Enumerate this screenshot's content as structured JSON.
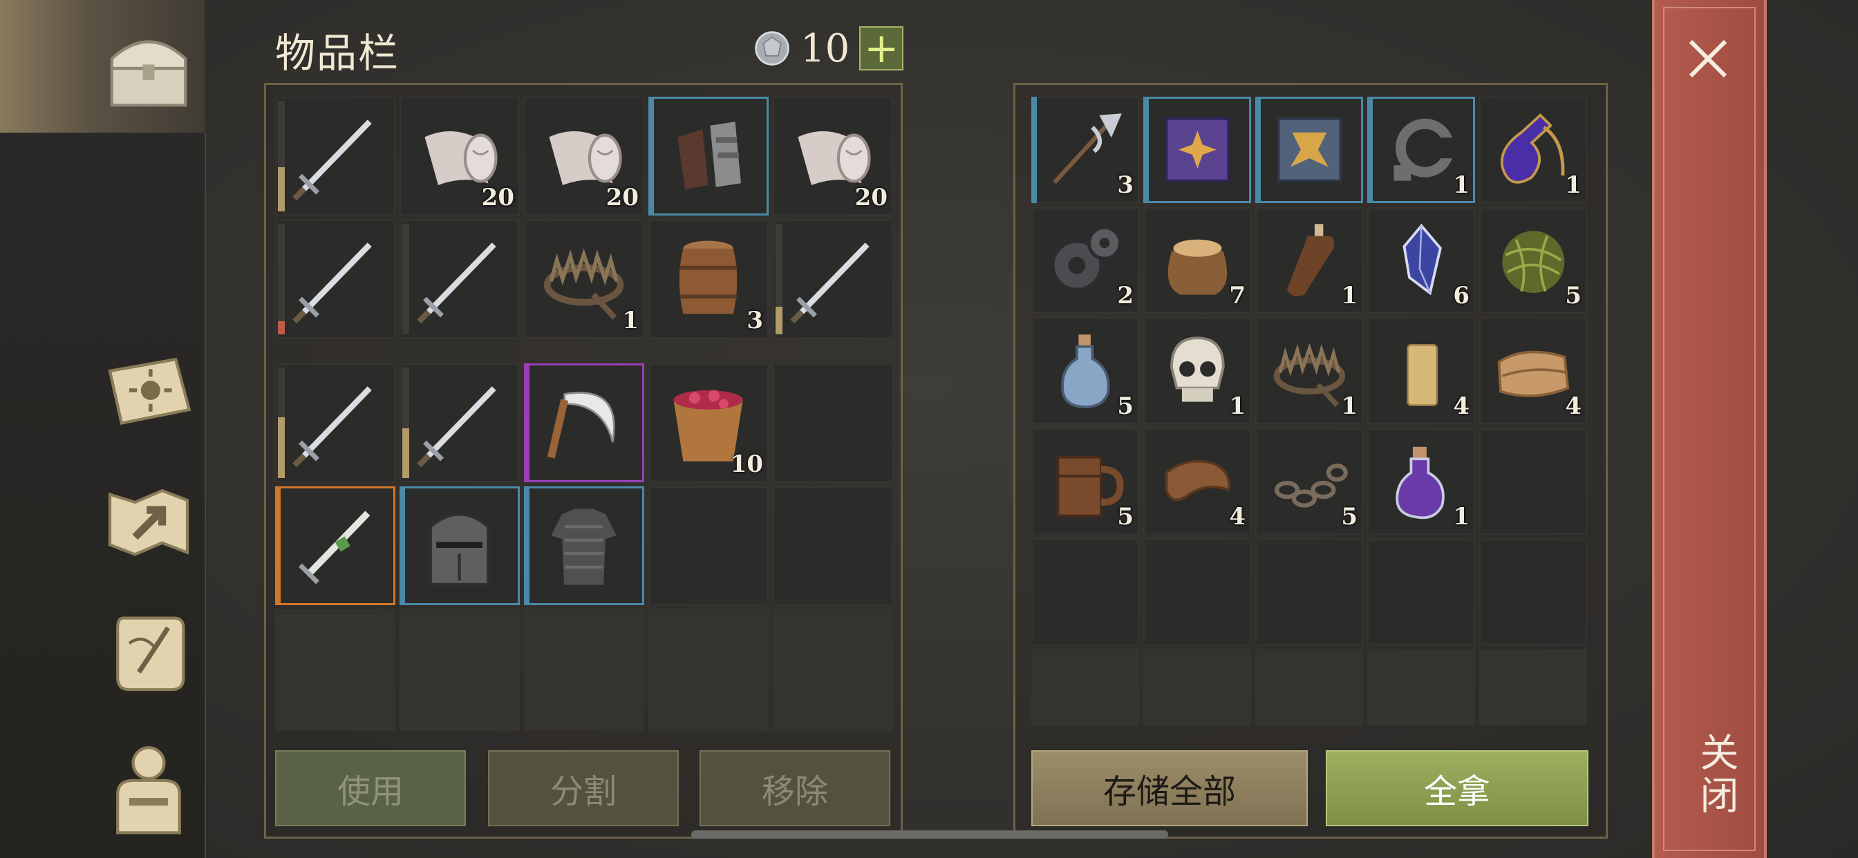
{
  "title": "物品栏",
  "currency": {
    "value": "10",
    "add_label": "+"
  },
  "sidebar": {
    "icons": [
      "treasure-chest-icon",
      "sun-book-icon",
      "crafting-map-icon",
      "quest-scroll-icon",
      "character-equipment-icon"
    ]
  },
  "inventory": {
    "upper": [
      {
        "icon": "sword-icon",
        "qty": "",
        "quality": "",
        "bar": 0.4,
        "bar_color": "#b39a6a"
      },
      {
        "icon": "cloth-roll-icon",
        "qty": "20",
        "quality": ""
      },
      {
        "icon": "cloth-roll-icon",
        "qty": "20",
        "quality": ""
      },
      {
        "icon": "gauntlets-icon",
        "qty": "",
        "quality": "blue"
      },
      {
        "icon": "cloth-roll-icon",
        "qty": "20",
        "quality": ""
      },
      {
        "icon": "sword-icon",
        "qty": "",
        "quality": "",
        "bar": 0.12,
        "bar_color": "#c25a4a"
      },
      {
        "icon": "sword-icon",
        "qty": "",
        "quality": "",
        "bar": 0.0,
        "bar_color": "#b39a6a"
      },
      {
        "icon": "bear-trap-icon",
        "qty": "1",
        "quality": ""
      },
      {
        "icon": "barrel-icon",
        "qty": "3",
        "quality": ""
      },
      {
        "icon": "sword-icon",
        "qty": "",
        "quality": "",
        "bar": 0.25,
        "bar_color": "#b39a6a"
      }
    ],
    "lower": [
      {
        "icon": "sword-icon",
        "qty": "",
        "quality": "",
        "bar": 0.55,
        "bar_color": "#b39a6a"
      },
      {
        "icon": "sword-icon",
        "qty": "",
        "quality": "",
        "bar": 0.45,
        "bar_color": "#b39a6a"
      },
      {
        "icon": "sickle-icon",
        "qty": "",
        "quality": "purple"
      },
      {
        "icon": "berry-bucket-icon",
        "qty": "10",
        "quality": ""
      },
      {
        "icon": "",
        "qty": "",
        "quality": ""
      },
      {
        "icon": "poison-dagger-icon",
        "qty": "",
        "quality": "orange"
      },
      {
        "icon": "great-helm-icon",
        "qty": "",
        "quality": "blue"
      },
      {
        "icon": "chainmail-armor-icon",
        "qty": "",
        "quality": "blue"
      },
      {
        "icon": "",
        "qty": "",
        "quality": ""
      },
      {
        "icon": "",
        "qty": "",
        "quality": ""
      },
      {
        "icon": "",
        "qty": "",
        "quality": "",
        "dim": true
      },
      {
        "icon": "",
        "qty": "",
        "quality": "",
        "dim": true
      },
      {
        "icon": "",
        "qty": "",
        "quality": "",
        "dim": true
      },
      {
        "icon": "",
        "qty": "",
        "quality": "",
        "dim": true
      },
      {
        "icon": "",
        "qty": "",
        "quality": "",
        "dim": true
      }
    ]
  },
  "storage": [
    {
      "icon": "halberd-icon",
      "qty": "3",
      "quality": "blue-rim",
      "glyph": "⚒"
    },
    {
      "icon": "purple-tome-icon",
      "qty": "",
      "quality": "blue"
    },
    {
      "icon": "blue-tome-icon",
      "qty": "",
      "quality": "blue"
    },
    {
      "icon": "iron-hook-icon",
      "qty": "1",
      "quality": "blue"
    },
    {
      "icon": "purple-potion-icon",
      "qty": "1",
      "quality": ""
    },
    {
      "icon": "gears-icon",
      "qty": "2",
      "quality": ""
    },
    {
      "icon": "grain-sack-icon",
      "qty": "7",
      "quality": ""
    },
    {
      "icon": "leather-flask-icon",
      "qty": "1",
      "quality": ""
    },
    {
      "icon": "blue-crystal-icon",
      "qty": "6",
      "quality": ""
    },
    {
      "icon": "twine-ball-icon",
      "qty": "5",
      "quality": ""
    },
    {
      "icon": "water-bottle-icon",
      "qty": "5",
      "quality": ""
    },
    {
      "icon": "skull-icon",
      "qty": "1",
      "quality": ""
    },
    {
      "icon": "bear-trap-icon",
      "qty": "1",
      "quality": ""
    },
    {
      "icon": "candle-icon",
      "qty": "4",
      "quality": ""
    },
    {
      "icon": "folded-cloth-icon",
      "qty": "4",
      "quality": ""
    },
    {
      "icon": "wooden-mug-icon",
      "qty": "5",
      "quality": ""
    },
    {
      "icon": "leather-scrap-icon",
      "qty": "4",
      "quality": ""
    },
    {
      "icon": "chain-icon",
      "qty": "5",
      "quality": ""
    },
    {
      "icon": "purple-flask-icon",
      "qty": "1",
      "quality": ""
    },
    {
      "icon": "",
      "qty": "",
      "quality": ""
    },
    {
      "icon": "",
      "qty": "",
      "quality": ""
    },
    {
      "icon": "",
      "qty": "",
      "quality": ""
    },
    {
      "icon": "",
      "qty": "",
      "quality": ""
    },
    {
      "icon": "",
      "qty": "",
      "quality": ""
    },
    {
      "icon": "",
      "qty": "",
      "quality": ""
    },
    {
      "icon": "",
      "qty": "",
      "quality": "",
      "dim": true
    },
    {
      "icon": "",
      "qty": "",
      "quality": "",
      "dim": true
    },
    {
      "icon": "",
      "qty": "",
      "quality": "",
      "dim": true
    },
    {
      "icon": "",
      "qty": "",
      "quality": "",
      "dim": true
    },
    {
      "icon": "",
      "qty": "",
      "quality": "",
      "dim": true
    }
  ],
  "buttons": {
    "use": "使用",
    "split": "分割",
    "remove": "移除",
    "store_all": "存储全部",
    "take_all": "全拿"
  },
  "close": {
    "label": "关闭"
  },
  "colors": {
    "quality_blue": "#4a8aa8",
    "quality_purple": "#9a3fb8",
    "quality_orange": "#d0782a",
    "take_all": "#8fa352",
    "close_strip": "#a84f44"
  }
}
